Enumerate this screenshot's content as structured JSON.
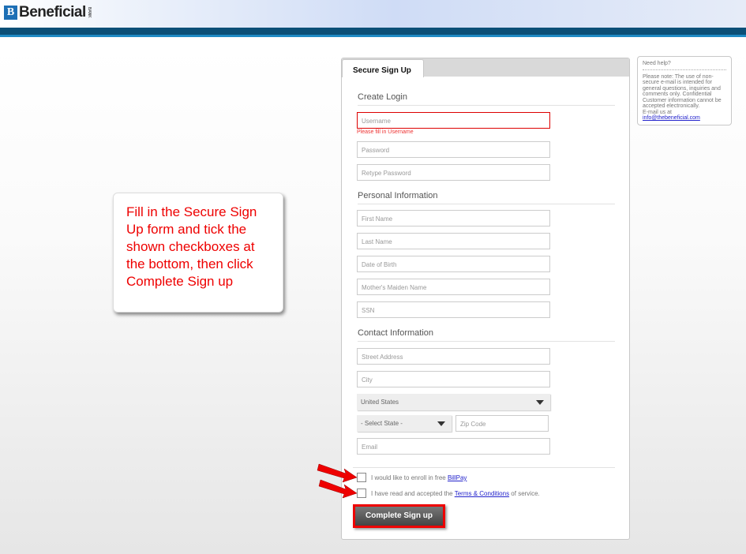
{
  "header": {
    "logo_text": "Beneficial",
    "logo_sub": "BANK",
    "logo_mark": "B"
  },
  "tab": "Secure Sign Up",
  "sections": {
    "login": "Create Login",
    "personal": "Personal Information",
    "contact": "Contact Information"
  },
  "fields": {
    "username": "Username",
    "username_error": "Please fill in Username",
    "password": "Password",
    "retype": "Retype Password",
    "first": "First Name",
    "last": "Last Name",
    "dob": "Date of Birth",
    "maiden": "Mother's Maiden Name",
    "ssn": "SSN",
    "street": "Street Address",
    "city": "City",
    "country": "United States",
    "state": "- Select State -",
    "zip": "Zip Code",
    "email": "Email"
  },
  "checks": {
    "billpay_pre": "I would like to enroll in free ",
    "billpay_link": "BillPay",
    "terms_pre": "I have read and accepted the ",
    "terms_link": "Terms & Conditions",
    "terms_post": " of service."
  },
  "submit": "Complete Sign up",
  "help": {
    "title": "Need help?",
    "body": "Please note: The use of non-secure e-mail is intended for general questions, inquiries and comments only. Confidential Customer information cannot be accepted electronically.",
    "email_pre": "E-mail us at",
    "email": "info@thebeneficial.com"
  },
  "callout": "Fill in the Secure Sign Up form and tick the shown checkboxes at the bottom, then click Complete Sign up",
  "colors": {
    "accent": "#e00000",
    "header_blue": "#0b4f77"
  }
}
